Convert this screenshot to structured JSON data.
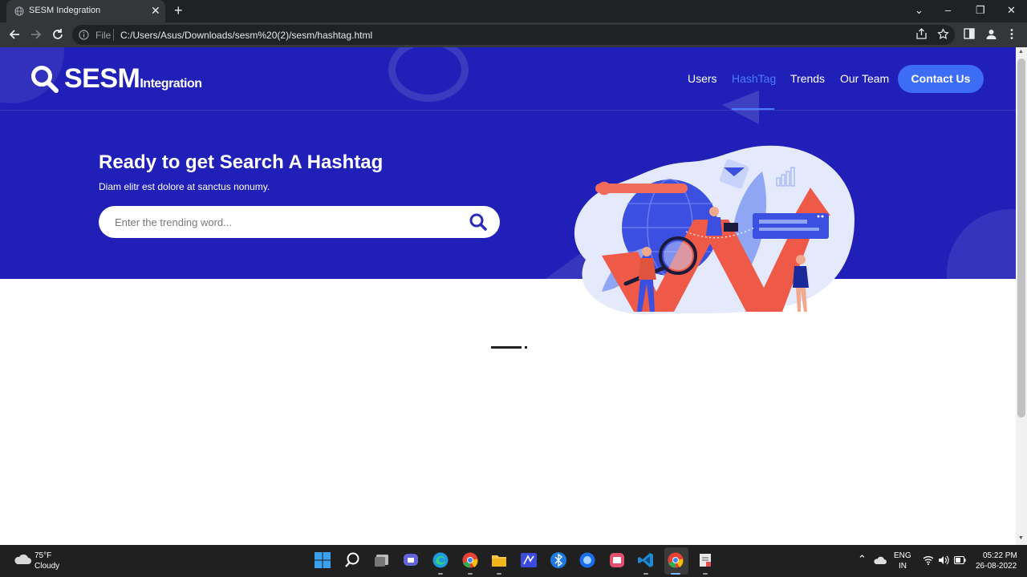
{
  "browser": {
    "tab_title": "SESM Indegration",
    "omnibox_scheme": "File",
    "url": "C:/Users/Asus/Downloads/sesm%20(2)/sesm/hashtag.html"
  },
  "site": {
    "logo_main": "SESM",
    "logo_sub": "Integration",
    "nav": [
      {
        "label": "Users"
      },
      {
        "label": "HashTag"
      },
      {
        "label": "Trends"
      },
      {
        "label": "Our Team"
      }
    ],
    "contact_label": "Contact Us",
    "active_nav": "HashTag"
  },
  "hero": {
    "title": "Ready to get Search A Hashtag",
    "subtitle": "Diam elitr est dolore at sanctus nonumy.",
    "search_placeholder": "Enter the trending word..."
  },
  "taskbar": {
    "temperature": "75°F",
    "condition": "Cloudy",
    "lang_line1": "ENG",
    "lang_line2": "IN",
    "time": "05:22 PM",
    "date": "26-08-2022"
  },
  "colors": {
    "hero_bg": "#2020b8",
    "accent": "#3d6cf5",
    "active_nav": "#4a7cff"
  }
}
